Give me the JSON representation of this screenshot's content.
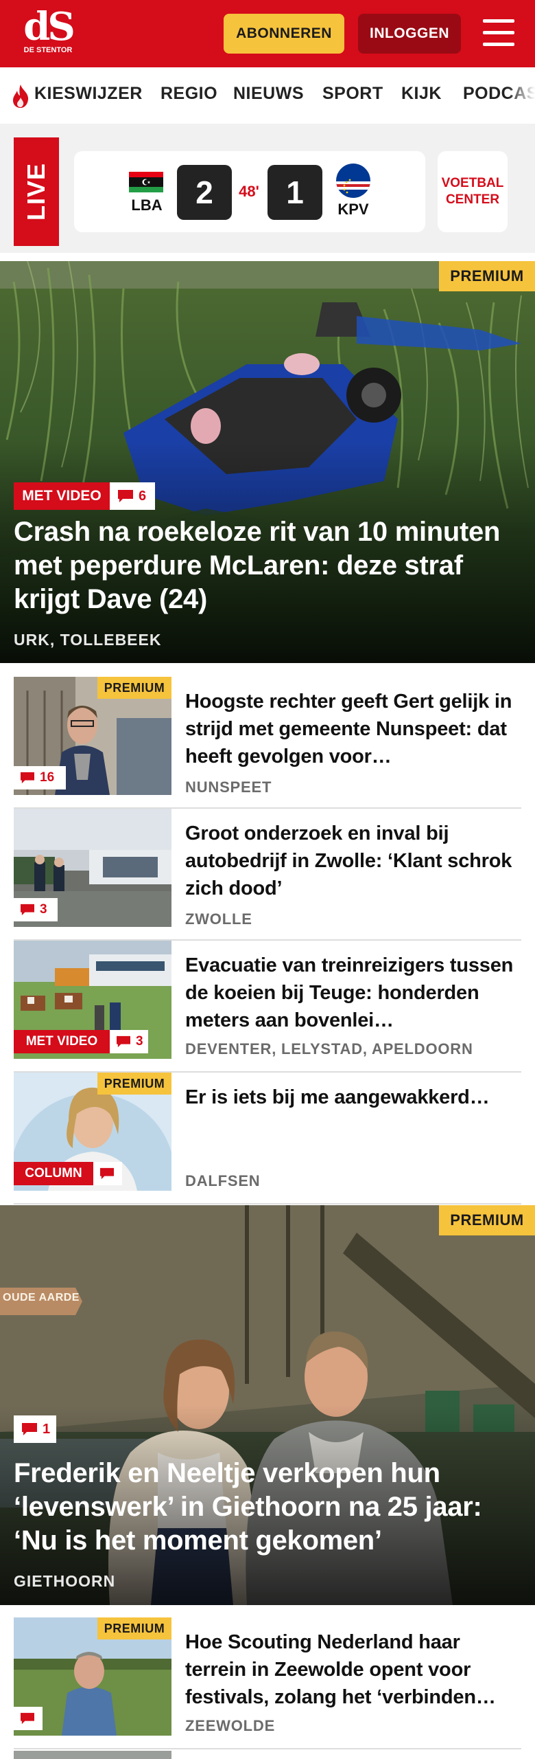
{
  "header": {
    "logo_mark": "dS",
    "logo_subtitle": "DE STENTOR",
    "subscribe_label": "ABONNEREN",
    "login_label": "INLOGGEN",
    "brand_color": "#d50c1a",
    "accent_color": "#f6c33c"
  },
  "nav": {
    "items": [
      "KIESWIJZER",
      "REGIO",
      "NIEUWS",
      "SPORT",
      "KIJK",
      "PODCAS"
    ]
  },
  "live": {
    "label": "LIVE",
    "home_team": "LBA",
    "home_score": "2",
    "minute": "48'",
    "away_team": "KPV",
    "away_score": "1",
    "center_label_line1": "VOETBAL",
    "center_label_line2": "CENTER"
  },
  "hero1": {
    "premium": "PREMIUM",
    "video_label": "MET VIDEO",
    "comments": "6",
    "title": "Crash na roekeloze rit van 10 minuten met peperdure McLaren: deze straf krijgt Dave (24)",
    "location": "URK, TOLLEBEEK"
  },
  "articles": [
    {
      "premium": "PREMIUM",
      "comments": "16",
      "title": "Hoogste rechter geeft Gert gelijk in strijd met gemeente Nunspeet: dat heeft gevolgen voor…",
      "location": "NUNSPEET"
    },
    {
      "comments": "3",
      "title": "Groot onderzoek en inval bij autobedrijf in Zwolle: ‘Klant schrok zich dood’",
      "location": "ZWOLLE"
    },
    {
      "video_label": "MET VIDEO",
      "comments": "3",
      "title": "Evacuatie van treinreizigers tussen de koeien bij Teuge: honderden meters aan bovenlei…",
      "location": "DEVENTER, LELYSTAD, APELDOORN"
    },
    {
      "premium": "PREMIUM",
      "column_label": "COLUMN",
      "title": "Er is iets bij me aangewakkerd…",
      "location": "DALFSEN"
    }
  ],
  "hero2": {
    "premium": "PREMIUM",
    "comments": "1",
    "sign_text": "OUDE AARDE",
    "title": "Frederik en Neeltje verkopen hun ‘levenswerk’ in Giethoorn na 25 jaar: ‘Nu is het moment gekomen’",
    "location": "GIETHOORN"
  },
  "article5": {
    "premium": "PREMIUM",
    "title": "Hoe Scouting Nederland haar terrein in Zeewolde opent voor festivals, zolang het ‘verbinden…",
    "location": "ZEEWOLDE"
  }
}
